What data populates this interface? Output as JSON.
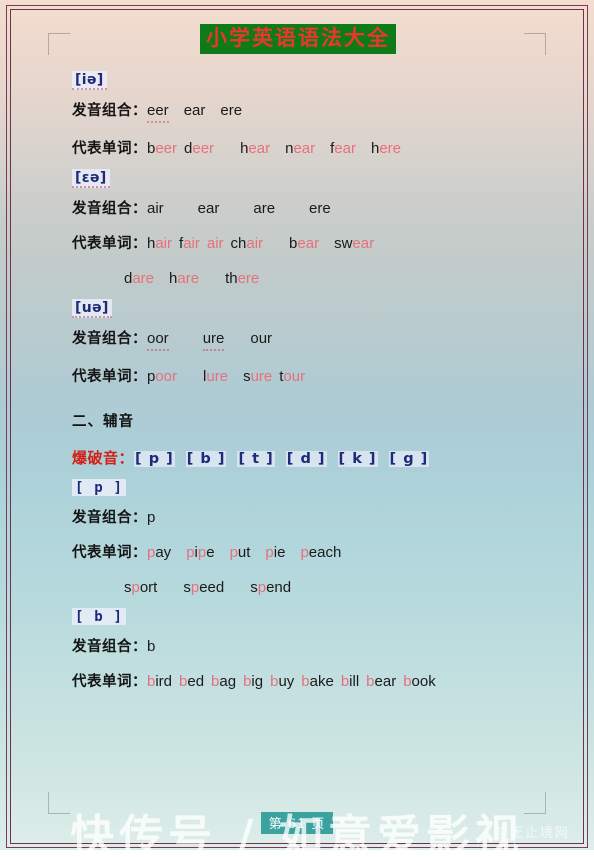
{
  "document": {
    "title": "小学英语语法大全",
    "title_text_color": "#e8382b",
    "title_highlight_color": "#0f7a18",
    "page_number": "第 61 页"
  },
  "labels": {
    "combination": "发音组合：",
    "examples": "代表单词："
  },
  "sections": [
    {
      "symbol": "[iə]",
      "combinations": [
        "eer",
        "ear",
        "ere"
      ],
      "words": [
        {
          "plain": "b",
          "red": "eer",
          "tail": ""
        },
        {
          "plain": "d",
          "red": "eer",
          "tail": ""
        },
        {
          "plain": "h",
          "red": "ear",
          "tail": ""
        },
        {
          "plain": "n",
          "red": "ear",
          "tail": ""
        },
        {
          "plain": "f",
          "red": "ear",
          "tail": ""
        },
        {
          "plain": "h",
          "red": "ere",
          "tail": ""
        }
      ],
      "words_line2": []
    },
    {
      "symbol": "[ɛə]",
      "combinations": [
        "air",
        "ear",
        "are",
        "ere"
      ],
      "words": [
        {
          "plain": "h",
          "red": "air",
          "tail": ""
        },
        {
          "plain": "f",
          "red": "air",
          "tail": ""
        },
        {
          "plain": "",
          "red": "air",
          "tail": ""
        },
        {
          "plain": "ch",
          "red": "air",
          "tail": ""
        },
        {
          "plain": "b",
          "red": "ear",
          "tail": ""
        },
        {
          "plain": "sw",
          "red": "ear",
          "tail": ""
        }
      ],
      "words_line2": [
        {
          "plain": "d",
          "red": "are",
          "tail": ""
        },
        {
          "plain": "h",
          "red": "are",
          "tail": ""
        },
        {
          "plain": "th",
          "red": "ere",
          "tail": ""
        }
      ]
    },
    {
      "symbol": "[uə]",
      "combinations": [
        "oor",
        "ure",
        "our"
      ],
      "words": [
        {
          "plain": "p",
          "red": "oor",
          "tail": ""
        },
        {
          "plain": "l",
          "red": "ure",
          "tail": ""
        },
        {
          "plain": "s",
          "red": "ure",
          "tail": ""
        },
        {
          "plain": "t",
          "red": "our",
          "tail": ""
        }
      ],
      "words_line2": []
    }
  ],
  "consonants": {
    "heading": "二、辅音",
    "plosive_label": "爆破音：",
    "plosive_symbols": [
      "[ p ]",
      "[ b ]",
      "[ t ]",
      "[ d ]",
      "[ k ]",
      "[ g ]"
    ],
    "plosive_label_color": "#d21f14",
    "symbol_color": "#1d2a78",
    "sections": [
      {
        "symbol": "[ p ]",
        "combinations": [
          "p"
        ],
        "words": [
          {
            "plain": "",
            "red": "p",
            "tail": "ay"
          },
          {
            "plain": "",
            "red": "p",
            "tail": "i",
            "red2": "p",
            "tail2": "e"
          },
          {
            "plain": "",
            "red": "p",
            "tail": "ut"
          },
          {
            "plain": "",
            "red": "p",
            "tail": "ie"
          },
          {
            "plain": "",
            "red": "p",
            "tail": "each"
          }
        ],
        "words_line2": [
          {
            "plain": "s",
            "red": "p",
            "tail": "ort"
          },
          {
            "plain": "s",
            "red": "p",
            "tail": "eed"
          },
          {
            "plain": "s",
            "red": "p",
            "tail": "end"
          }
        ]
      },
      {
        "symbol": "[ b ]",
        "combinations": [
          "b"
        ],
        "words": [
          {
            "plain": "",
            "red": "b",
            "tail": "ird"
          },
          {
            "plain": "",
            "red": "b",
            "tail": "ed"
          },
          {
            "plain": "",
            "red": "b",
            "tail": "ag"
          },
          {
            "plain": "",
            "red": "b",
            "tail": "ig"
          },
          {
            "plain": "",
            "red": "b",
            "tail": "uy"
          },
          {
            "plain": "",
            "red": "b",
            "tail": "ake"
          },
          {
            "plain": "",
            "red": "b",
            "tail": "ill"
          },
          {
            "plain": "",
            "red": "b",
            "tail": "ear"
          },
          {
            "plain": "",
            "red": "b",
            "tail": "ook"
          }
        ],
        "words_line2": []
      }
    ]
  },
  "watermark": {
    "main": "快传号 / 如意爱影视",
    "sub": "学无止境网"
  }
}
